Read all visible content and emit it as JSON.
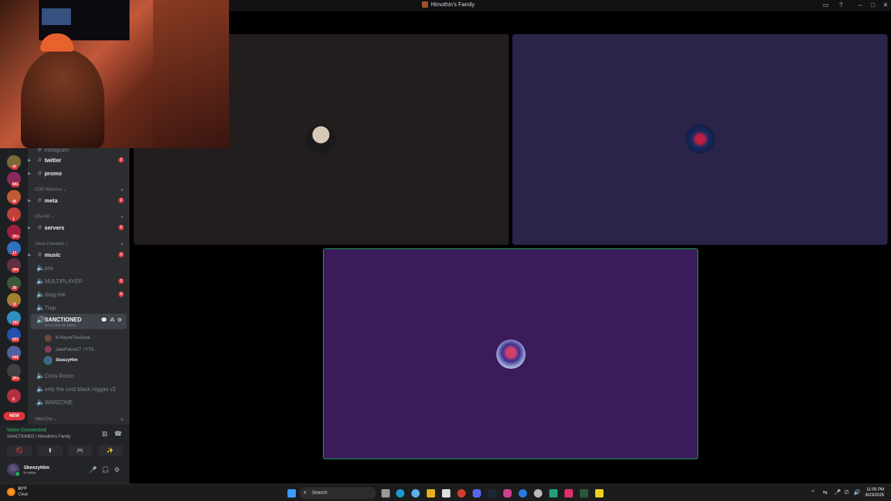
{
  "window": {
    "title": "Himothin's Family",
    "controls": {
      "inbox": "▭",
      "help": "?",
      "minimize": "–",
      "maximize": "□",
      "close": "✕"
    }
  },
  "server_rail": {
    "badges": [
      "47",
      "641",
      "80",
      "1",
      "1K+",
      "17",
      "354",
      "30",
      "33",
      "182",
      "623",
      "649",
      "2K+",
      "2"
    ],
    "new_label": "NEW"
  },
  "channels": {
    "cut_off_item": "instagram",
    "items": [
      {
        "name": "twitter",
        "type": "text",
        "unread": true,
        "mention": "2"
      },
      {
        "name": "promo",
        "type": "text",
        "unread": true,
        "mention": ""
      },
      {
        "name": "meta",
        "type": "text",
        "unread": true,
        "mention": "2"
      },
      {
        "name": "servers",
        "type": "text",
        "unread": true,
        "mention": "2"
      },
      {
        "name": "music",
        "type": "text",
        "unread": true,
        "mention": "2"
      },
      {
        "name": "priv",
        "type": "voice",
        "unread": false,
        "mention": ""
      },
      {
        "name": "MULTIPLAYER",
        "type": "voice",
        "unread": false,
        "mention": "2"
      },
      {
        "name": "drag-me",
        "type": "voice",
        "unread": false,
        "mention": "2"
      },
      {
        "name": "Trap",
        "type": "voice",
        "unread": false,
        "mention": ""
      },
      {
        "name": "Chris Room",
        "type": "voice",
        "unread": false,
        "mention": ""
      },
      {
        "name": "only the cool black niggas v2",
        "type": "voice",
        "unread": false,
        "mention": ""
      },
      {
        "name": "WARZONE",
        "type": "voice",
        "unread": false,
        "mention": ""
      }
    ],
    "categories": [
      "COD Warzone",
      "GTA RP",
      "Voice Channels",
      "HiMoThin"
    ],
    "active": {
      "name": "SANCTIONED",
      "status": "Set a channel status",
      "icons": "💬 ⁂ ⚙"
    },
    "voice_users": [
      {
        "name": "B WayneTheGreat",
        "speaking": false
      },
      {
        "name": "JakeFuture27 ⚡YTG",
        "speaking": false
      },
      {
        "name": "SkeezyHim",
        "speaking": true
      }
    ]
  },
  "voice_panel": {
    "status": "Voice Connected",
    "location": "SANCTIONED / Himothin's Family",
    "buttons": [
      "🚫",
      "⬆",
      "🎮",
      "✨"
    ],
    "noise_icon": "▥",
    "disconnect_icon": "☎"
  },
  "user_panel": {
    "name": "SkeezyHim",
    "status": "In voice",
    "controls": [
      "🎤",
      "🎧",
      "⚙"
    ]
  },
  "tiles": {
    "colors": {
      "tile1": "#221e1d",
      "tile2": "#2a2448",
      "tile3": "#3a1c5a",
      "speaking_border": "#23a55a"
    }
  },
  "taskbar": {
    "weather_temp": "80°F",
    "weather_desc": "Clear",
    "search_label": "Search",
    "time": "11:05 PM",
    "date": "8/23/2025",
    "tray": [
      "^",
      "⇆",
      "🎤",
      "⎚",
      "🔊"
    ]
  }
}
